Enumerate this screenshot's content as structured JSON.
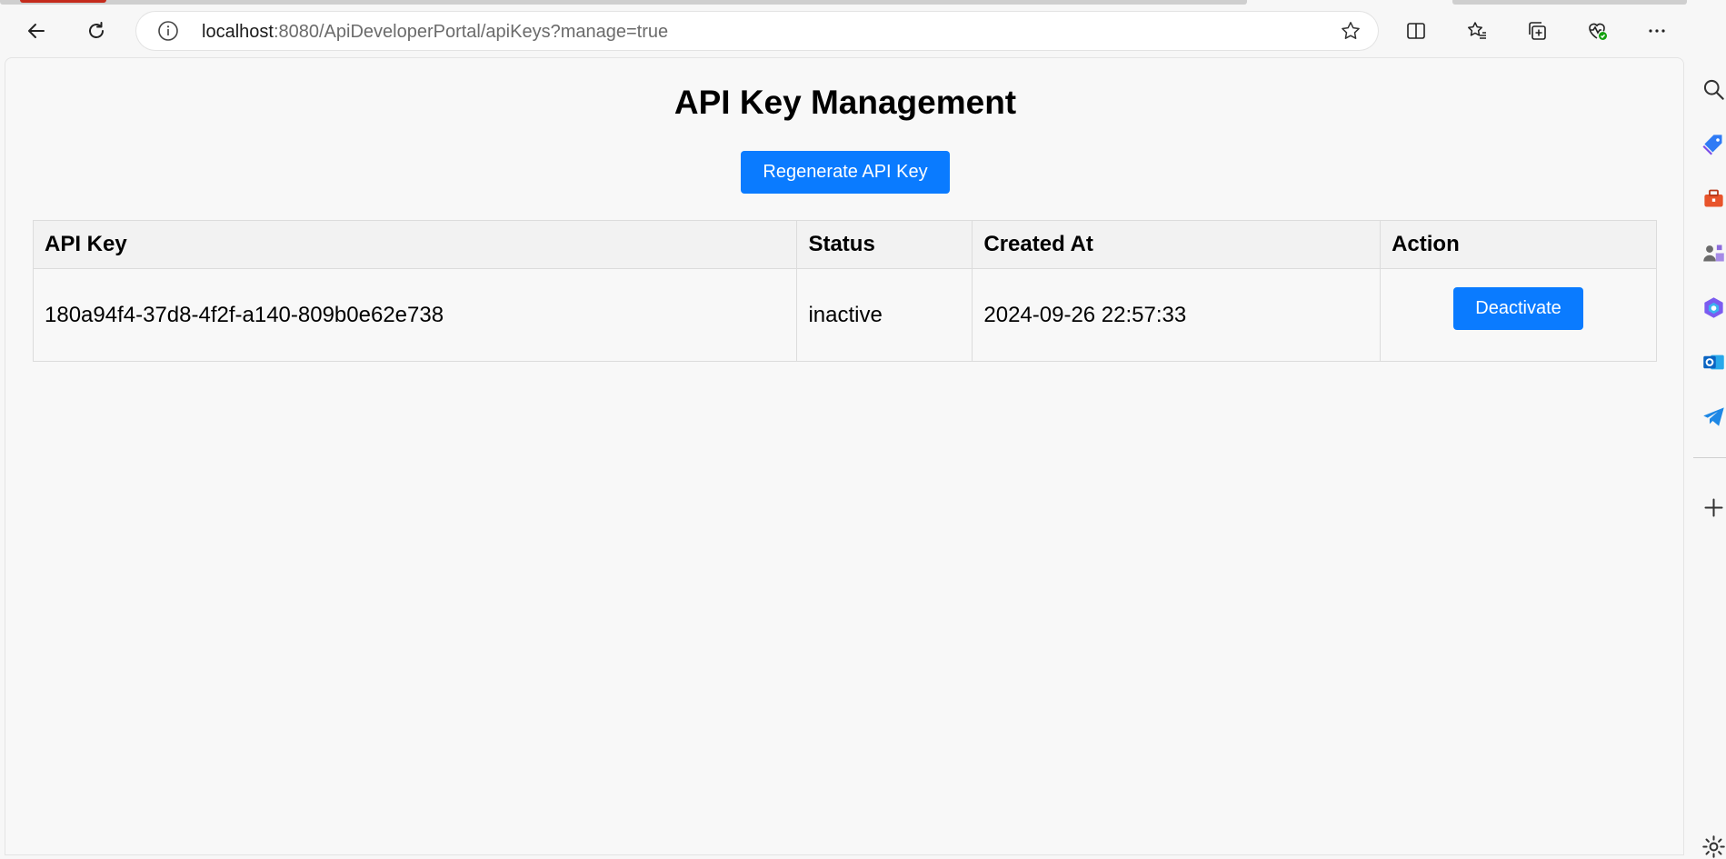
{
  "browser": {
    "url_host": "localhost",
    "url_rest": ":8080/ApiDeveloperPortal/apiKeys?manage=true",
    "icons": [
      "back-icon",
      "refresh-icon",
      "site-info-icon",
      "favorite-star-icon",
      "split-screen-icon",
      "favorites-icon",
      "collections-icon",
      "browser-essentials-icon",
      "more-icon",
      "copilot-icon"
    ],
    "sidebar_icons": [
      "search-icon",
      "shopping-tag-icon",
      "tools-icon",
      "games-icon",
      "microsoft-365-icon",
      "outlook-icon",
      "telegram-icon",
      "add-icon",
      "settings-icon"
    ]
  },
  "page": {
    "title": "API Key Management",
    "regenerate_label": "Regenerate API Key"
  },
  "table": {
    "headers": [
      "API Key",
      "Status",
      "Created At",
      "Action"
    ],
    "rows": [
      {
        "api_key": "180a94f4-37d8-4f2f-a140-809b0e62e738",
        "status": "inactive",
        "created_at": "2024-09-26 22:57:33",
        "action_label": "Deactivate"
      }
    ]
  },
  "colors": {
    "primary_button": "#0a7bff",
    "page_background": "#f8f8f8",
    "header_background": "#f2f2f2"
  }
}
